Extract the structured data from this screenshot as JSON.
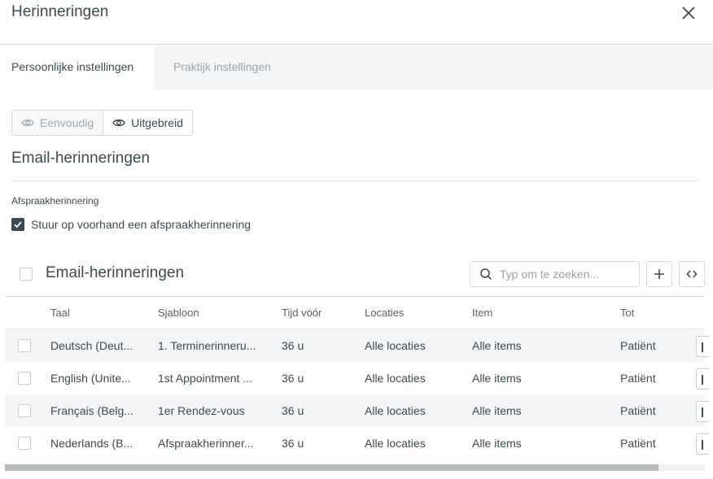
{
  "dialog": {
    "title": "Herinneringen",
    "close_icon": "close-icon"
  },
  "tabs": [
    {
      "label": "Persoonlijke instellingen",
      "active": true
    },
    {
      "label": "Praktijk instellingen",
      "active": false
    }
  ],
  "view_toggle": {
    "simple_label": "Eenvoudig",
    "advanced_label": "Uitgebreid",
    "selected": "Uitgebreid"
  },
  "section": {
    "title": "Email-herinneringen",
    "field_label": "Afspraakherinnering",
    "checkbox_label": "Stuur op voorhand een afspraakherinnering",
    "checkbox_checked": true
  },
  "table": {
    "title": "Email-herinneringen",
    "search_placeholder": "Typ om te zoeken...",
    "add_icon": "plus-icon",
    "code_icon": "code-brackets-icon",
    "columns": [
      "Taal",
      "Sjabloon",
      "Tijd vóór",
      "Locaties",
      "Item",
      "Tot"
    ],
    "rows": [
      [
        "Deutsch (Deut...",
        "1. Terminerinneru...",
        "36 u",
        "Alle locaties",
        "Alle items",
        "Patiënt"
      ],
      [
        "English (Unite...",
        "1st Appointment ...",
        "36 u",
        "Alle locaties",
        "Alle items",
        "Patiënt"
      ],
      [
        "Français (Belg...",
        "1er Rendez-vous",
        "36 u",
        "Alle locaties",
        "Alle items",
        "Patiënt"
      ],
      [
        "Nederlands (B...",
        "Afspraakherinner...",
        "36 u",
        "Alle locaties",
        "Alle items",
        "Patiënt"
      ]
    ]
  },
  "colors": {
    "text": "#3b4a52",
    "muted": "#9aa3a8",
    "accent": "#3c4a53",
    "stripe": "#f4f5f6"
  }
}
